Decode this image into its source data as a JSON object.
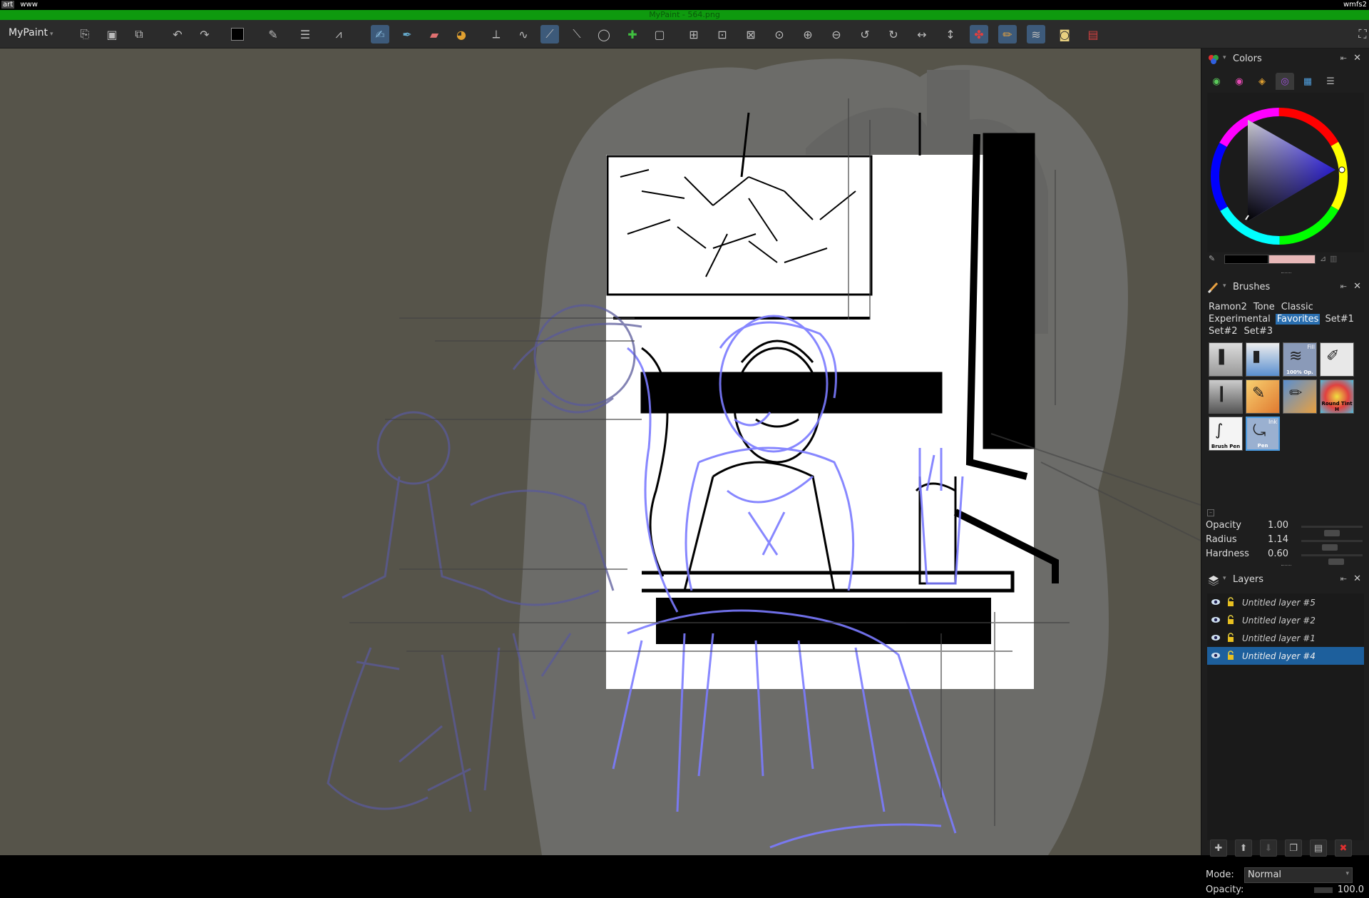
{
  "system_bar": {
    "workspace_1": "art",
    "workspace_2": "www",
    "right_label": "wmfs2"
  },
  "window": {
    "title": "MyPaint - 564.png"
  },
  "toolbar": {
    "app_menu_label": "MyPaint",
    "buttons": [
      "open-icon",
      "save-icon",
      "export-icon",
      "undo-icon",
      "redo-icon",
      "color-swatch-icon",
      "brush-selector-icon",
      "layer-menu-icon",
      "symmetry-icon",
      "freehand-tool-icon",
      "inking-tool-icon",
      "eraser-icon",
      "color-picker-icon",
      "symmetry-axis-icon",
      "freehand-lasso-icon",
      "pen-icon",
      "line-icon",
      "ellipse-icon",
      "add-icon",
      "frame-icon",
      "fit-view-icon",
      "zoom-fit-icon",
      "reset-view-icon",
      "zoom-reset-icon",
      "zoom-in-icon",
      "zoom-out-icon",
      "rotate-left-icon",
      "rotate-right-icon",
      "mirror-h-icon",
      "mirror-v-icon",
      "colors-panel-icon",
      "brush-panel-icon",
      "layers-panel-icon",
      "scratchpad-icon",
      "preview-icon",
      "fullscreen-icon"
    ]
  },
  "colors_panel": {
    "title": "Colors",
    "tabs": [
      "palette-tab",
      "wheel-tab",
      "sets-tab",
      "hcy-tab",
      "cube-tab",
      "list-tab"
    ],
    "accent": "#e8b8b8",
    "current_color": "#000000"
  },
  "brushes_panel": {
    "title": "Brushes",
    "categories": [
      "Ramon2",
      "Tone",
      "Classic",
      "Experimental",
      "Favorites",
      "Set#1",
      "Set#2",
      "Set#3"
    ],
    "selected_category": "Favorites",
    "brushes": [
      {
        "label": "",
        "icon": "airbrush"
      },
      {
        "label": "",
        "icon": "eraser"
      },
      {
        "label": "100% Op.",
        "icon": "fill"
      },
      {
        "label": "",
        "icon": "pencil"
      },
      {
        "label": "",
        "icon": "charcoal"
      },
      {
        "label": "",
        "icon": "marker"
      },
      {
        "label": "",
        "icon": "oil-brush"
      },
      {
        "label": "Round Tint H",
        "icon": "tint"
      },
      {
        "label": "Brush Pen",
        "icon": "brush-pen"
      },
      {
        "label": "Pen",
        "icon": "ink-pen"
      }
    ],
    "fill_tag": "Fill",
    "ink_tag": "Ink",
    "selected_brush": "Pen"
  },
  "brush_settings": [
    {
      "label": "Opacity",
      "value": "1.00",
      "fraction": 0.5
    },
    {
      "label": "Radius",
      "value": "1.14",
      "fraction": 0.45
    },
    {
      "label": "Hardness",
      "value": "0.60",
      "fraction": 0.6
    }
  ],
  "layers_panel": {
    "title": "Layers",
    "layers": [
      {
        "name": "Untitled layer #5",
        "selected": false
      },
      {
        "name": "Untitled layer #2",
        "selected": false
      },
      {
        "name": "Untitled layer #1",
        "selected": false
      },
      {
        "name": "Untitled layer #4",
        "selected": true
      }
    ],
    "mode_label": "Mode:",
    "mode_value": "Normal",
    "opacity_label": "Opacity:",
    "opacity_value": "100.0"
  }
}
